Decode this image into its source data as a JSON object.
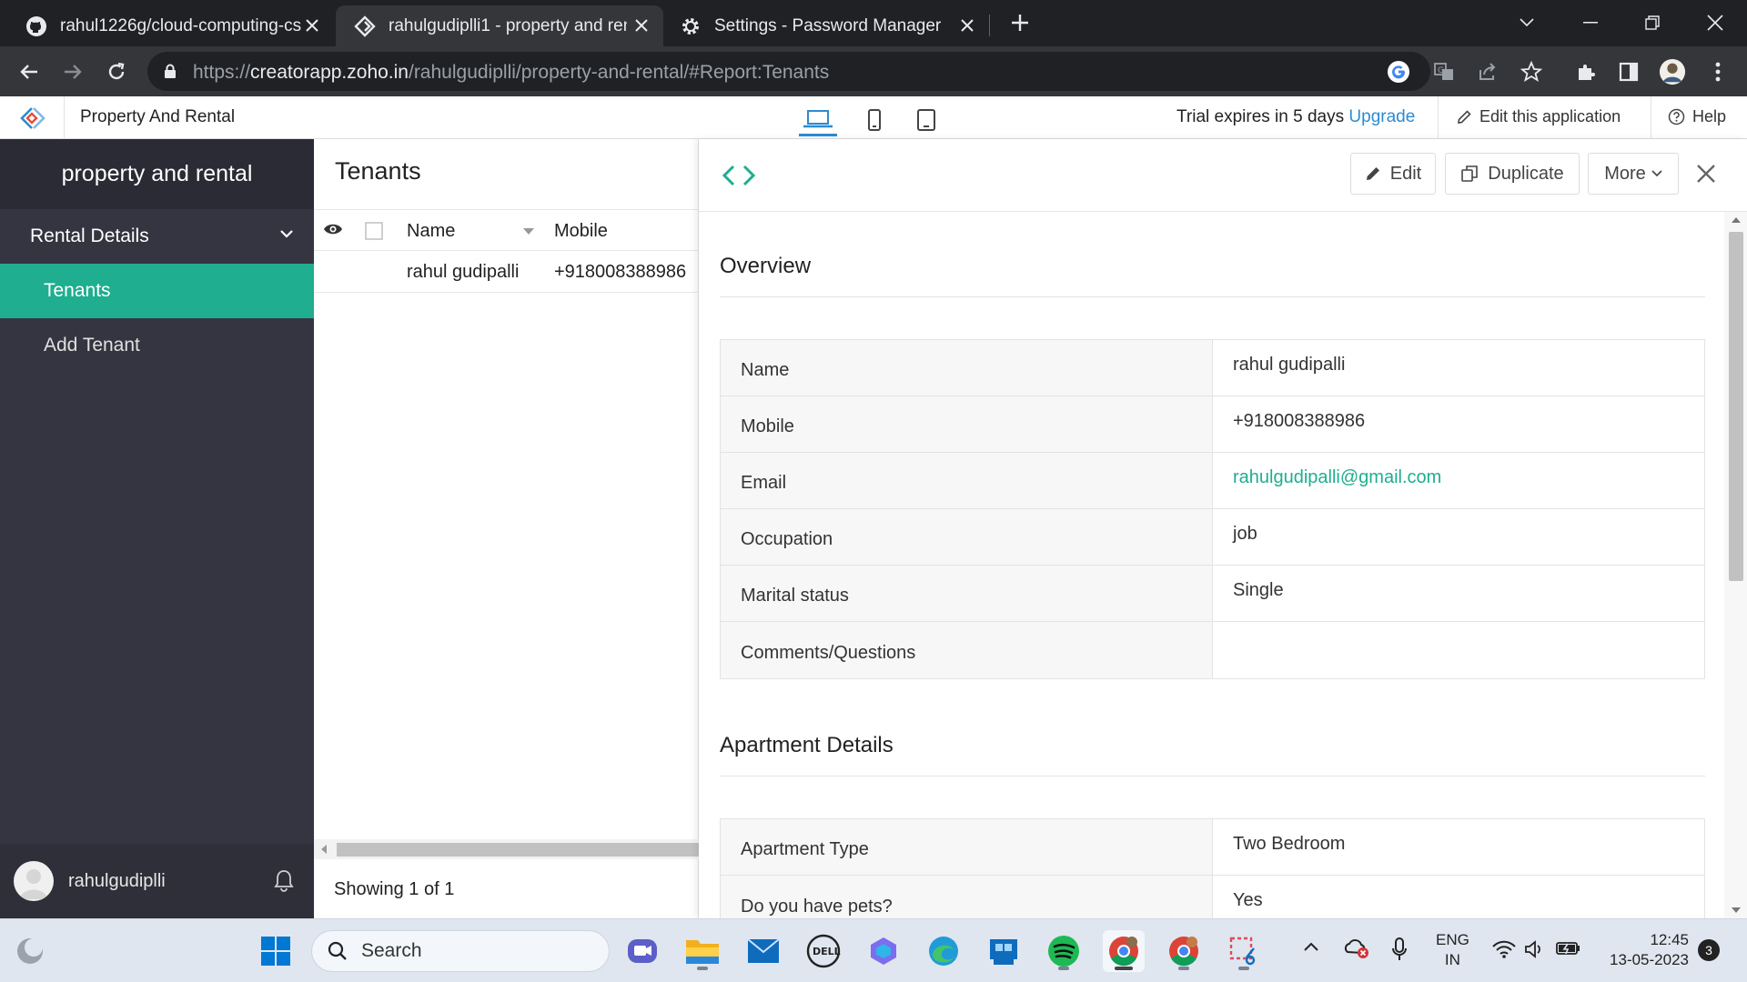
{
  "browser": {
    "tabs": [
      {
        "title": "rahul1226g/cloud-computing-cs",
        "icon": "github-icon"
      },
      {
        "title": "rahulgudiplli1 - property and ren",
        "icon": "zoho-creator-icon"
      },
      {
        "title": "Settings - Password Manager",
        "icon": "gear-icon"
      }
    ],
    "url_scheme": "https://",
    "url_host": "creatorapp.zoho.in",
    "url_path": "/rahulgudiplli/property-and-rental/#Report:Tenants"
  },
  "appbar": {
    "app_title": "Property And Rental",
    "trial_prefix": "Trial expires in ",
    "trial_days": "5",
    "trial_suffix": " days ",
    "upgrade_label": "Upgrade",
    "edit_app_label": "Edit this application",
    "help_label": "Help",
    "accent_color": "#2d8bd2"
  },
  "sidebar": {
    "app_name": "property and rental",
    "section_label": "Rental Details",
    "items": [
      {
        "label": "Tenants",
        "active": true
      },
      {
        "label": "Add Tenant",
        "active": false
      }
    ],
    "username": "rahulgudiplli",
    "active_color": "#1fae8f"
  },
  "report": {
    "title": "Tenants",
    "columns": [
      "Name",
      "Mobile"
    ],
    "rows": [
      {
        "name": "rahul gudipalli",
        "mobile": "+918008388986"
      }
    ],
    "footer_prefix": "Showing ",
    "footer_count": "1 of 1"
  },
  "detail": {
    "buttons": {
      "edit": "Edit",
      "duplicate": "Duplicate",
      "more": "More"
    },
    "overview_title": "Overview",
    "overview_fields": [
      {
        "label": "Name",
        "value": "rahul gudipalli"
      },
      {
        "label": "Mobile",
        "value": "+918008388986"
      },
      {
        "label": "Email",
        "value": "rahulgudipalli@gmail.com"
      },
      {
        "label": "Occupation",
        "value": "job"
      },
      {
        "label": "Marital status",
        "value": "Single"
      },
      {
        "label": "Comments/Questions",
        "value": ""
      }
    ],
    "apartment_title": "Apartment Details",
    "apartment_fields": [
      {
        "label": "Apartment Type",
        "value": "Two Bedroom"
      },
      {
        "label": "Do you have pets?",
        "value": "Yes"
      }
    ]
  },
  "taskbar": {
    "search_label": "Search",
    "lang_line1": "ENG",
    "lang_line2": "IN",
    "time": "12:45",
    "date": "13-05-2023",
    "notification_count": "3"
  }
}
